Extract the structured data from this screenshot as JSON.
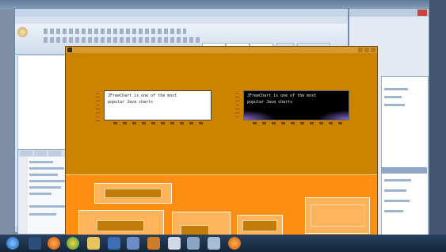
{
  "word": {
    "title": "",
    "tabs": [
      "",
      "",
      "",
      "",
      "",
      "",
      ""
    ]
  },
  "frame": {
    "title": "",
    "chart_left": {
      "placeholder_text": "JFreeChart is one of the most\npopular Java charts"
    },
    "chart_right": {
      "placeholder_text": "JFreeChart is one of the most\npopular Java charts"
    },
    "lower_panel_label": "",
    "buttons": []
  },
  "taskbar": {
    "items": [
      "windows",
      "explorer",
      "media",
      "chrome",
      "folder",
      "word",
      "ide",
      "java",
      "notepad",
      "tool",
      "firefox"
    ],
    "clock_time": "",
    "clock_date": ""
  },
  "colors": {
    "frame_bg": "#cc8400",
    "lower_bg": "#ff8f12",
    "panel_bg": "#ffb35a",
    "button_bg": "#c27a09"
  }
}
